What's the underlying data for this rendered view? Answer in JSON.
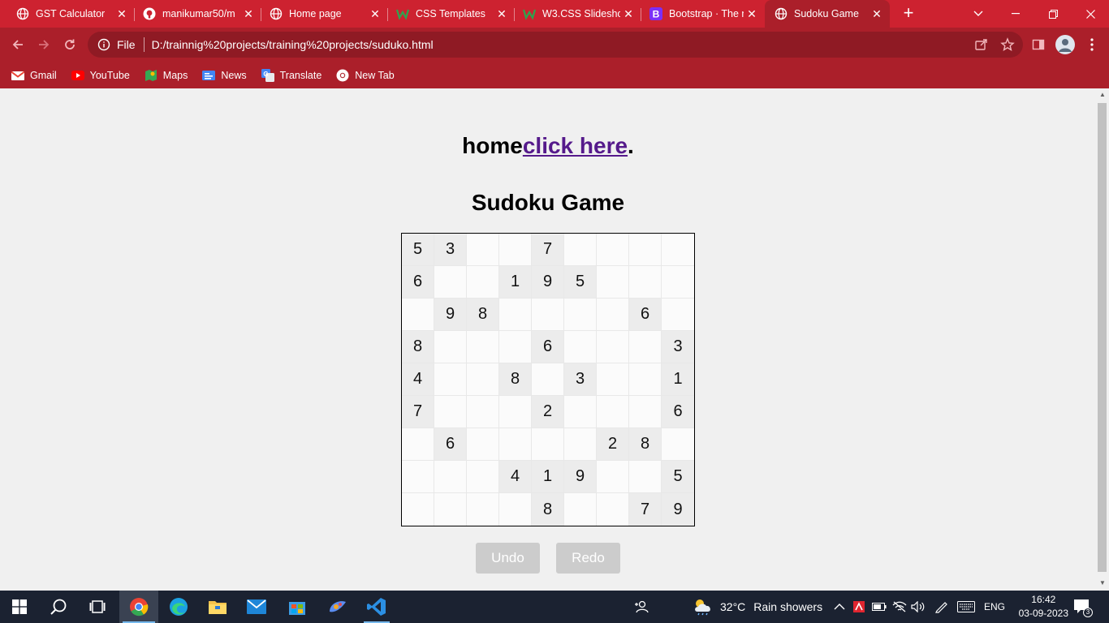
{
  "tabs": [
    {
      "title": "GST Calculator",
      "icon": "globe-icon"
    },
    {
      "title": "manikumar50/m",
      "icon": "github-icon"
    },
    {
      "title": "Home page",
      "icon": "globe-icon"
    },
    {
      "title": "CSS Templates",
      "icon": "w3schools-icon"
    },
    {
      "title": "W3.CSS Slidesho",
      "icon": "w3schools-icon"
    },
    {
      "title": "Bootstrap · The n",
      "icon": "bootstrap-icon"
    },
    {
      "title": "Sudoku Game",
      "icon": "globe-icon",
      "active": true
    }
  ],
  "address": {
    "scheme_label": "File",
    "url": "D:/trainnig%20projects/training%20projects/suduko.html"
  },
  "bookmarks": [
    {
      "label": "Gmail",
      "icon": "gmail-icon"
    },
    {
      "label": "YouTube",
      "icon": "youtube-icon"
    },
    {
      "label": "Maps",
      "icon": "maps-icon"
    },
    {
      "label": "News",
      "icon": "news-icon"
    },
    {
      "label": "Translate",
      "icon": "translate-icon"
    },
    {
      "label": "New Tab",
      "icon": "chrome-icon"
    }
  ],
  "page": {
    "home_text": "home",
    "home_link": "click here",
    "home_period": ".",
    "title": "Sudoku Game",
    "grid": [
      [
        "5",
        "3",
        "",
        "",
        "7",
        "",
        "",
        "",
        ""
      ],
      [
        "6",
        "",
        "",
        "1",
        "9",
        "5",
        "",
        "",
        ""
      ],
      [
        "",
        "9",
        "8",
        "",
        "",
        "",
        "",
        "6",
        ""
      ],
      [
        "8",
        "",
        "",
        "",
        "6",
        "",
        "",
        "",
        "3"
      ],
      [
        "4",
        "",
        "",
        "8",
        "",
        "3",
        "",
        "",
        "1"
      ],
      [
        "7",
        "",
        "",
        "",
        "2",
        "",
        "",
        "",
        "6"
      ],
      [
        "",
        "6",
        "",
        "",
        "",
        "",
        "2",
        "8",
        ""
      ],
      [
        "",
        "",
        "",
        "4",
        "1",
        "9",
        "",
        "",
        "5"
      ],
      [
        "",
        "",
        "",
        "",
        "8",
        "",
        "",
        "7",
        "9"
      ]
    ],
    "undo_label": "Undo",
    "redo_label": "Redo"
  },
  "taskbar": {
    "weather_temp": "32°C",
    "weather_desc": "Rain showers",
    "lang": "ENG",
    "time": "16:42",
    "date": "03-09-2023",
    "notifications": "3"
  },
  "colors": {
    "chrome_accent": "#cd2230",
    "chrome_dark": "#ab1f2a",
    "link": "#551a8b"
  }
}
